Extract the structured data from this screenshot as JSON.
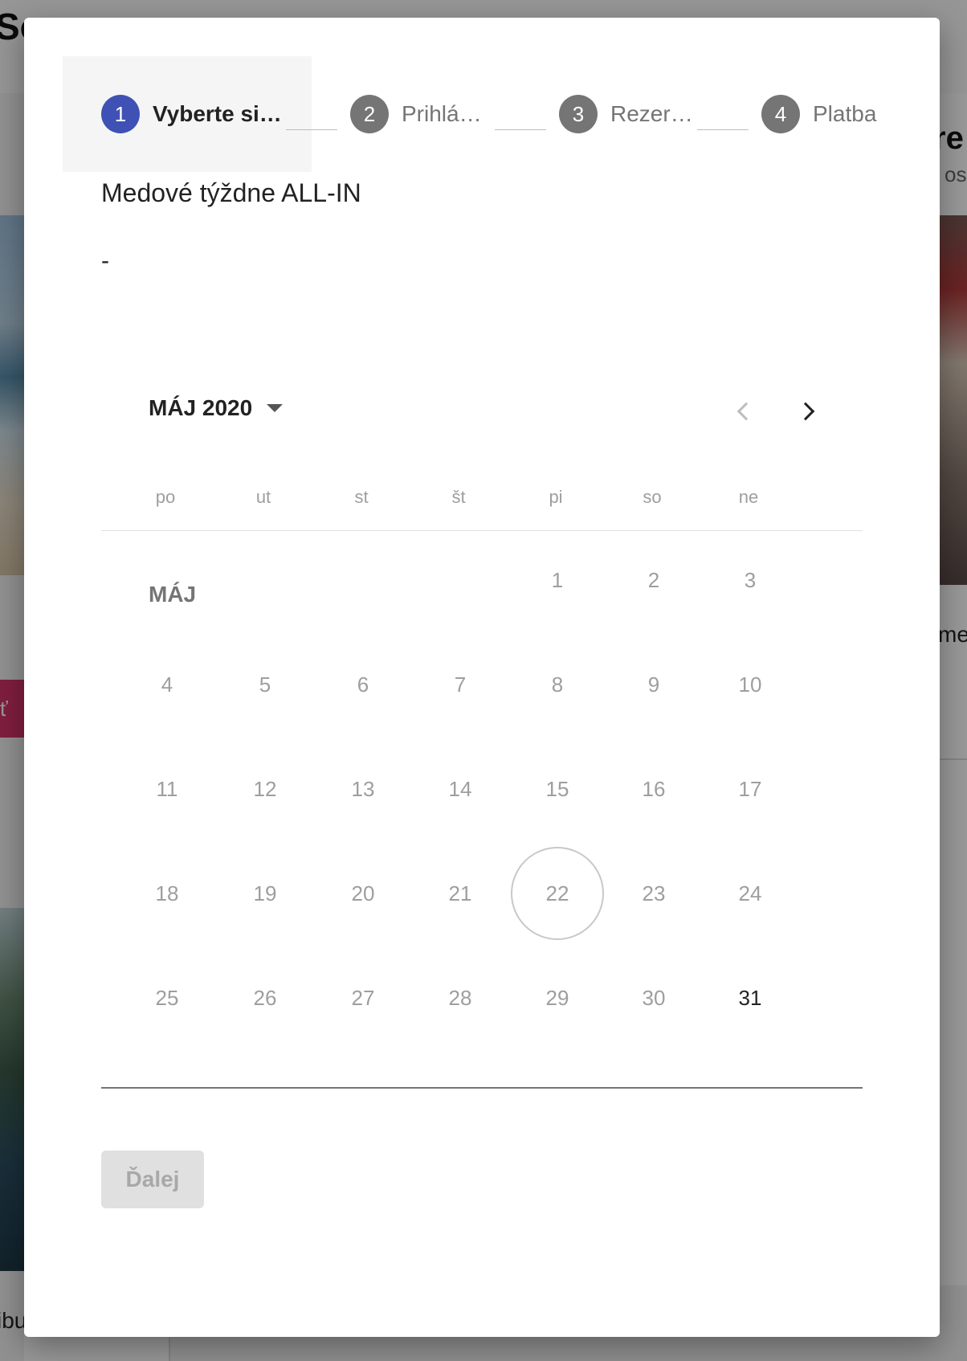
{
  "background": {
    "title_fragment": "So",
    "left_button_fragment": "ť o",
    "left_text_fragment": "ibu",
    "right_heading_fragment": "re",
    "right_sub_fragment": "os",
    "right_text_fragment": "me"
  },
  "stepper": {
    "steps": [
      {
        "number": "1",
        "label": "Vyberte si…",
        "state": "active"
      },
      {
        "number": "2",
        "label": "Prihlá…",
        "state": "inactive"
      },
      {
        "number": "3",
        "label": "Rezer…",
        "state": "inactive"
      },
      {
        "number": "4",
        "label": "Platba",
        "state": "inactive"
      }
    ]
  },
  "package": {
    "title": "Medové týždne ALL-IN",
    "subtitle": "-"
  },
  "calendar": {
    "period_label": "MÁJ 2020",
    "month_row_label": "MÁJ",
    "weekdays": [
      "po",
      "ut",
      "st",
      "št",
      "pi",
      "so",
      "ne"
    ],
    "first_weekday_index": 4,
    "days_in_month": 31,
    "today": 22,
    "available_days": [
      31
    ],
    "prev_icon": "chevron-left-icon",
    "next_icon": "chevron-right-icon"
  },
  "actions": {
    "next_label": "Ďalej"
  },
  "colors": {
    "accent": "#3f51b5",
    "step_inactive": "#757575",
    "day_disabled": "#9e9e9e",
    "day_available": "#222222"
  }
}
